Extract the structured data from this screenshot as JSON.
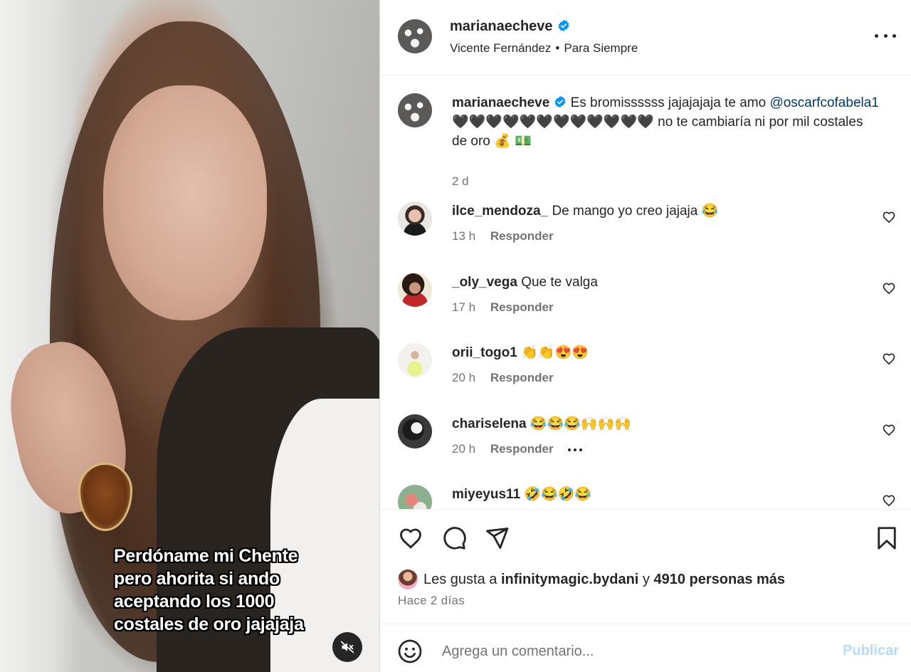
{
  "media": {
    "caption": "Perdóname mi Chente\npero ahorita si ando\naceptando los  1000\ncostales de oro jajajaja"
  },
  "header": {
    "username": "marianaecheve",
    "song_artist": "Vicente Fernández",
    "song_separator": "•",
    "song_title": "Para Siempre"
  },
  "caption": {
    "username": "marianaecheve",
    "text_1": "Es bromissssss jajajajaja te amo",
    "mention": "@oscarfcofabela1",
    "hearts": "🖤🖤🖤🖤🖤🖤🖤🖤🖤🖤🖤🖤",
    "text_2": "no te cambiaría ni por mil costales de oro 💰 💵",
    "time": "2 d"
  },
  "comments": [
    {
      "username": "ilce_mendoza_",
      "text": "De mango yo creo jajaja 😂",
      "time": "13 h",
      "reply": "Responder"
    },
    {
      "username": "_oly_vega",
      "text": "Que te valga",
      "time": "17 h",
      "reply": "Responder"
    },
    {
      "username": "orii_togo1",
      "text": "👏👏😍😍",
      "time": "20 h",
      "reply": "Responder"
    },
    {
      "username": "chariselena",
      "text": "😂😂😂🙌🙌🙌",
      "time": "20 h",
      "reply": "Responder"
    },
    {
      "username": "miyeyus11",
      "text": "🤣😂🤣😂",
      "time": "",
      "reply": ""
    }
  ],
  "likes": {
    "prefix": "Les gusta a",
    "user": "infinitymagic.bydani",
    "conj": "y",
    "others": "4910 personas más"
  },
  "post_time": "Hace 2 días",
  "comment_bar": {
    "placeholder": "Agrega un comentario...",
    "publish_label": "Publicar"
  },
  "colors": {
    "verified": "#0095f6",
    "mention": "#00376b",
    "publish_disabled": "#b3dbff",
    "secondary_text": "#737373"
  }
}
